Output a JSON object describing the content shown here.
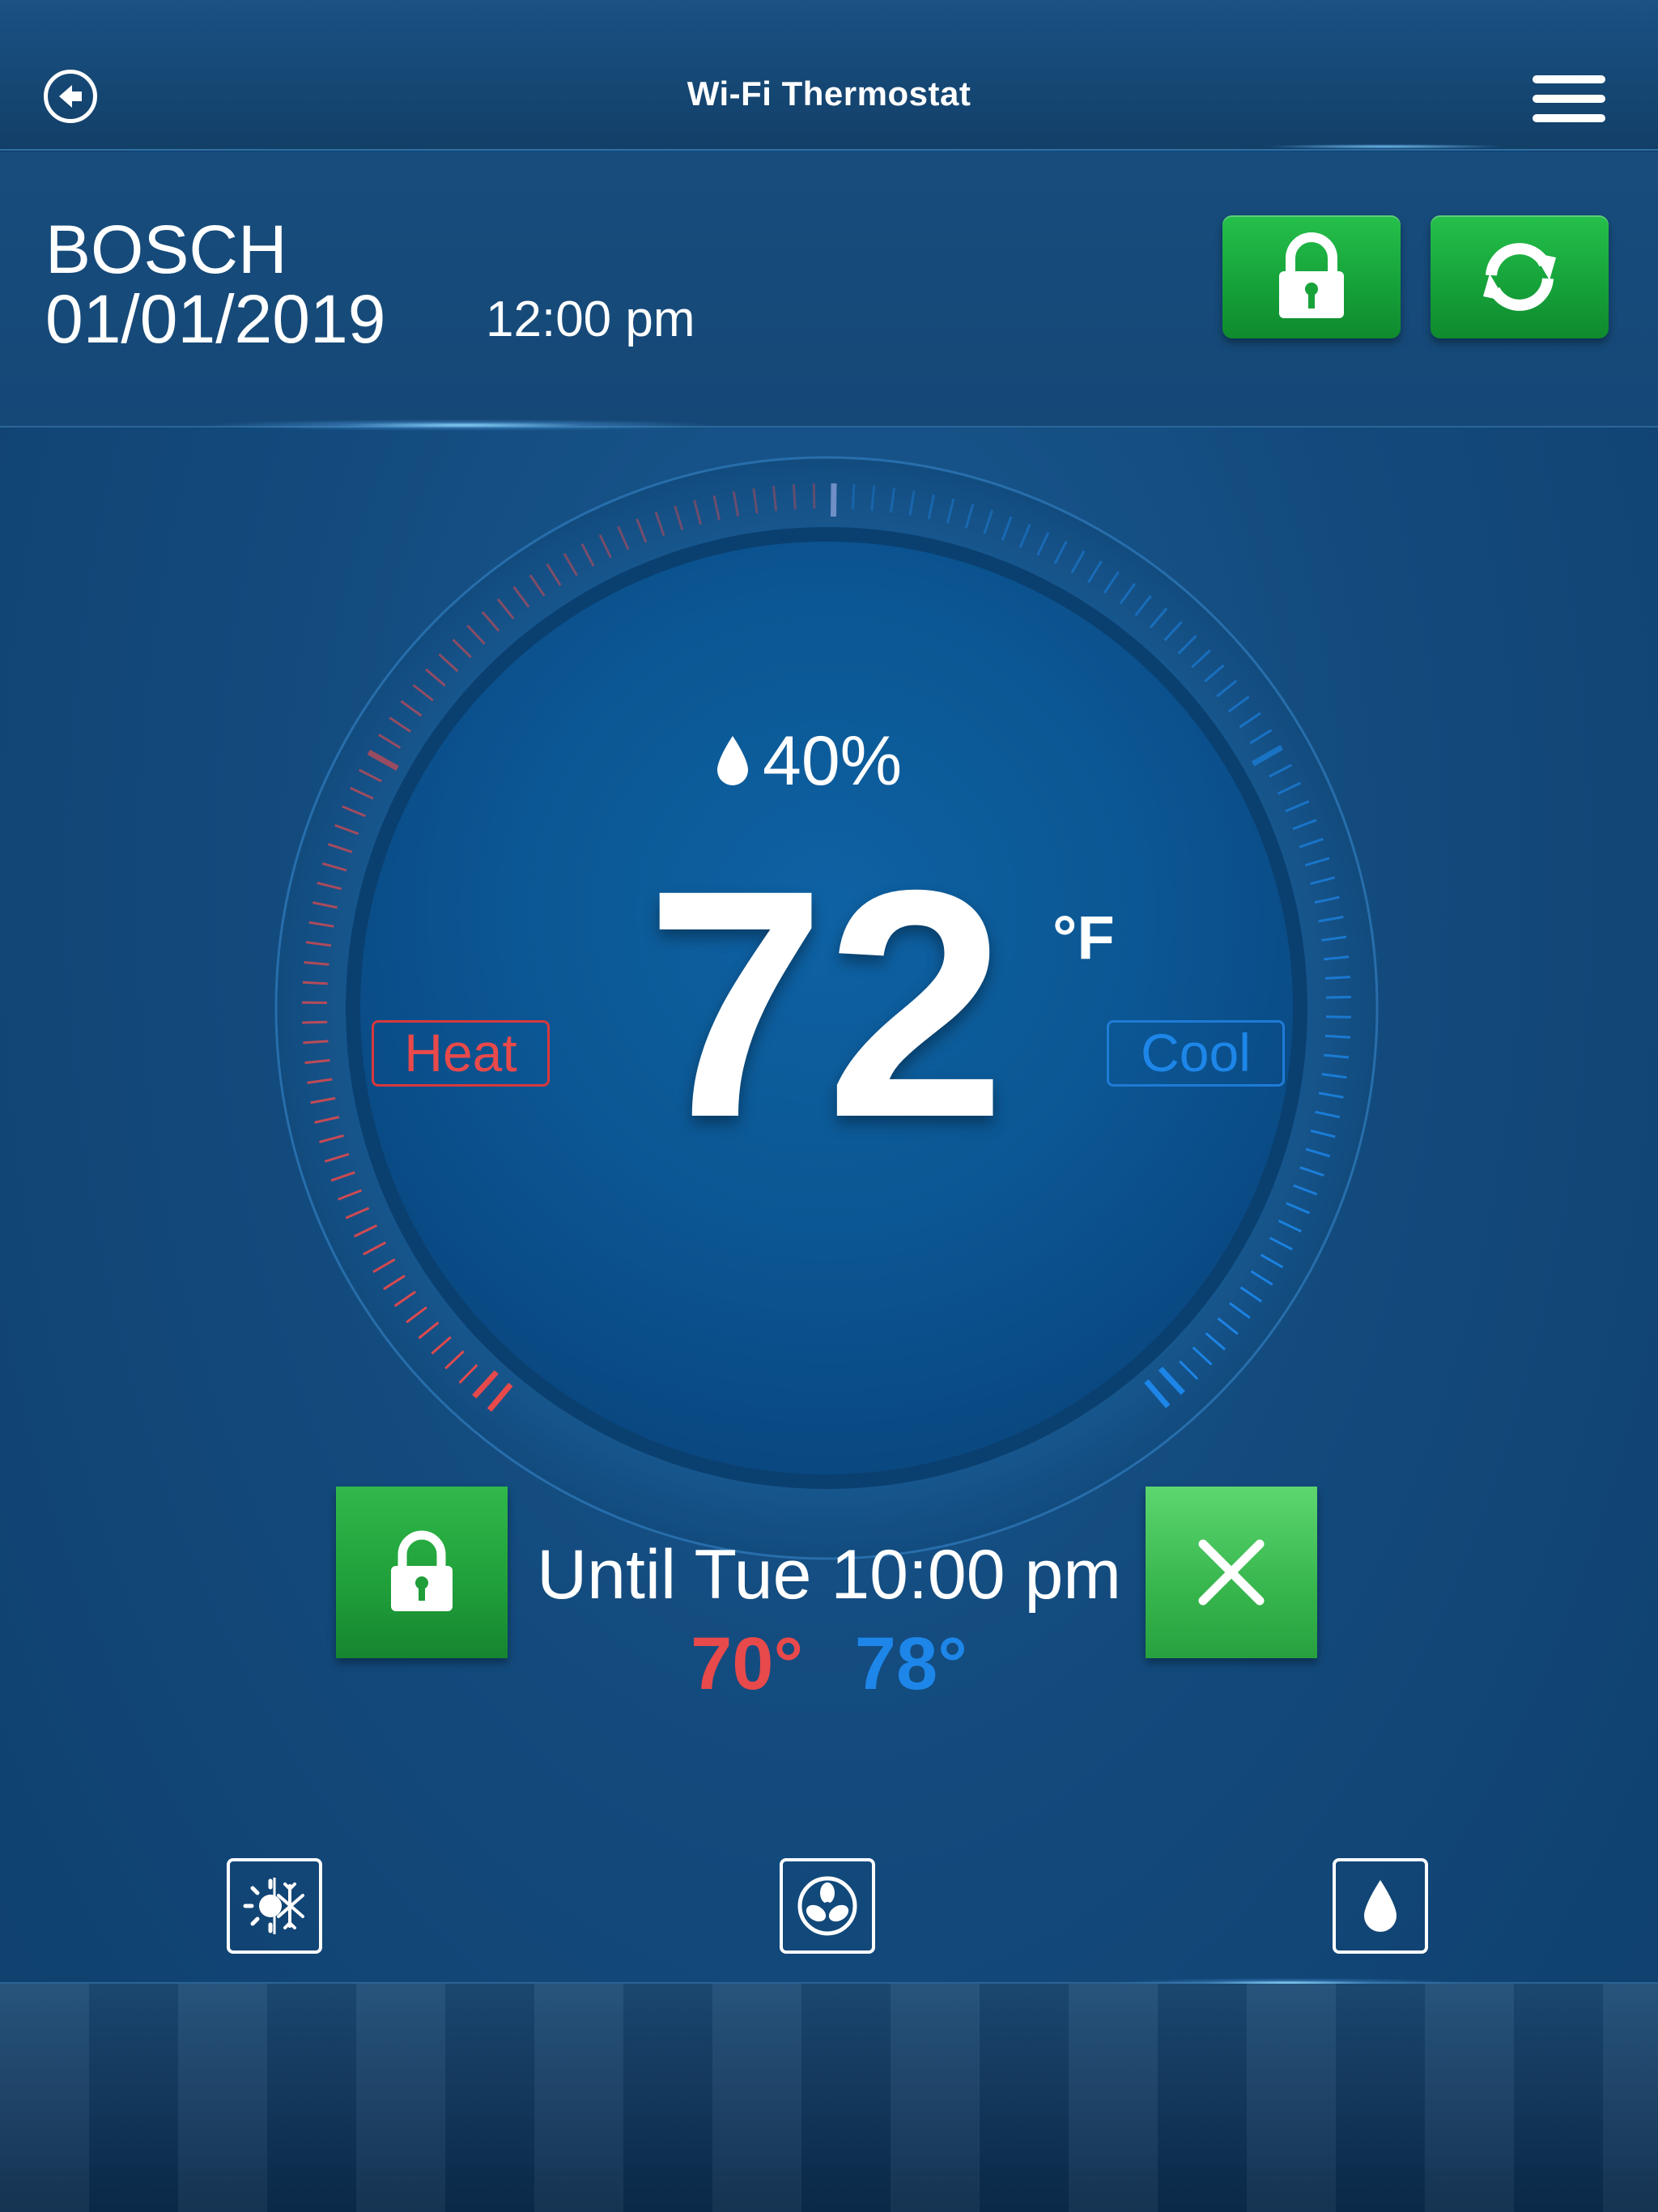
{
  "header": {
    "title": "Wi-Fi Thermostat"
  },
  "info": {
    "brand": "BOSCH",
    "date": "01/01/2019",
    "time": "12:00 pm"
  },
  "dial": {
    "humidity": "40%",
    "temperature": "72",
    "unit": "°F",
    "heat_label": "Heat",
    "cool_label": "Cool"
  },
  "hold": {
    "until_text": "Until Tue 10:00 pm",
    "heat_setpoint": "70°",
    "cool_setpoint": "78°"
  },
  "colors": {
    "heat": "#e8494b",
    "cool": "#1d86e8",
    "button_green": "#1fa53c",
    "background": "#134b7e"
  },
  "icons": {
    "back": "back-arrow-icon",
    "menu": "hamburger-menu-icon",
    "lock": "lock-icon",
    "refresh": "refresh-icon",
    "close": "close-icon",
    "mode": "heat-cool-mode-icon",
    "fan": "fan-icon",
    "humidity": "water-drop-icon"
  }
}
